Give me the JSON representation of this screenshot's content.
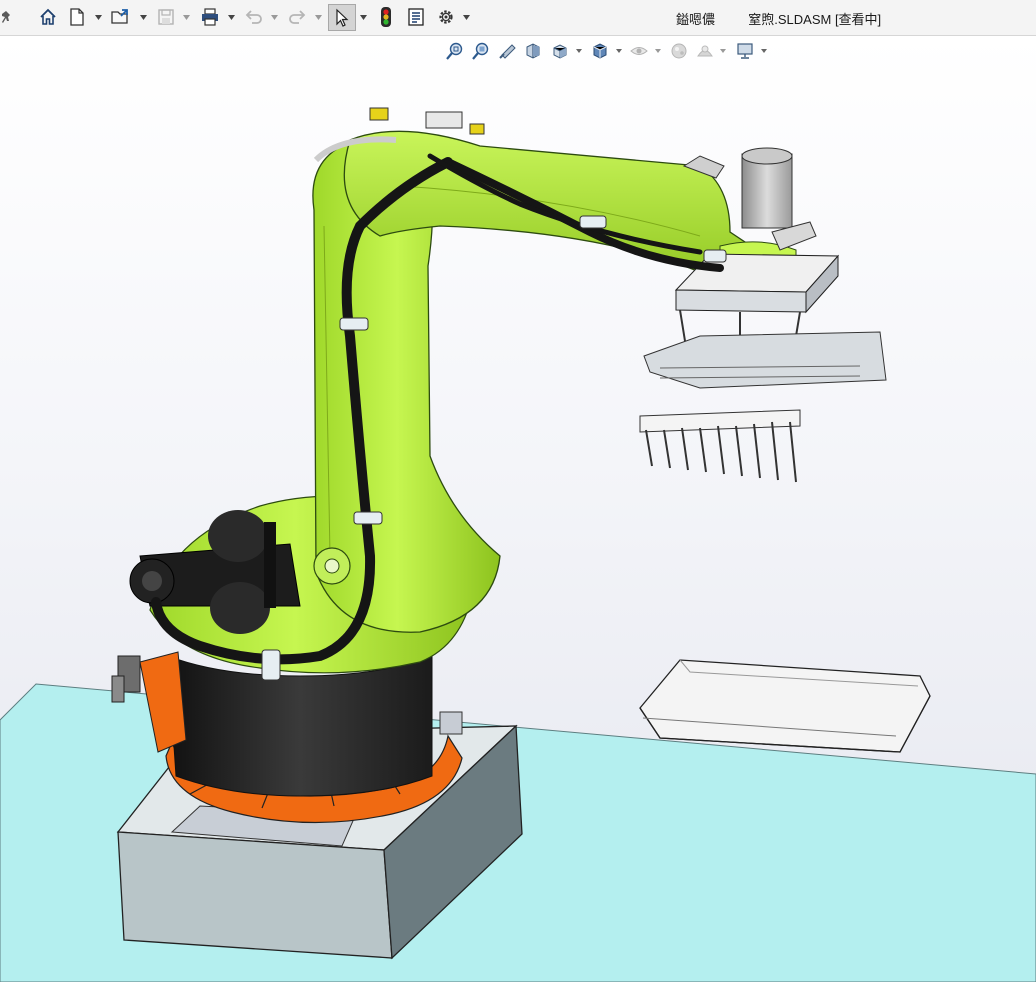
{
  "toolbar": {
    "items": [
      {
        "name": "pin-icon"
      },
      {
        "name": "home-icon"
      },
      {
        "name": "new-document-icon"
      },
      {
        "name": "open-icon"
      },
      {
        "name": "save-icon"
      },
      {
        "name": "print-icon"
      },
      {
        "name": "undo-icon"
      },
      {
        "name": "redo-icon"
      },
      {
        "name": "select-cursor-icon"
      },
      {
        "name": "traffic-light-icon"
      },
      {
        "name": "file-properties-icon"
      },
      {
        "name": "options-gear-icon"
      }
    ],
    "title_left": "鎰嗯儂",
    "title_file": "窒煦.SLDASM [查看中]"
  },
  "heads_up_toolbar": {
    "items": [
      {
        "name": "zoom-to-fit-icon"
      },
      {
        "name": "zoom-to-area-icon"
      },
      {
        "name": "previous-view-icon"
      },
      {
        "name": "section-view-icon"
      },
      {
        "name": "view-orientation-icon"
      },
      {
        "name": "display-style-icon"
      },
      {
        "name": "hide-show-items-icon"
      },
      {
        "name": "edit-appearance-icon"
      },
      {
        "name": "apply-scene-icon"
      },
      {
        "name": "view-settings-icon"
      }
    ]
  },
  "scene": {
    "model": "palletizing-robot-assembly",
    "colors": {
      "robot_body": "#b8f03a",
      "robot_shadow": "#8ec21f",
      "base_ring": "#f06a12",
      "base_cylinder": "#2a2a2a",
      "pedestal_top": "#dfe4e6",
      "pedestal_side": "#a9b7bb",
      "floor": "#b4efef",
      "cable": "#151515",
      "gripper": "#d7dce0",
      "conveyor_box": "#f3f3f3"
    }
  }
}
